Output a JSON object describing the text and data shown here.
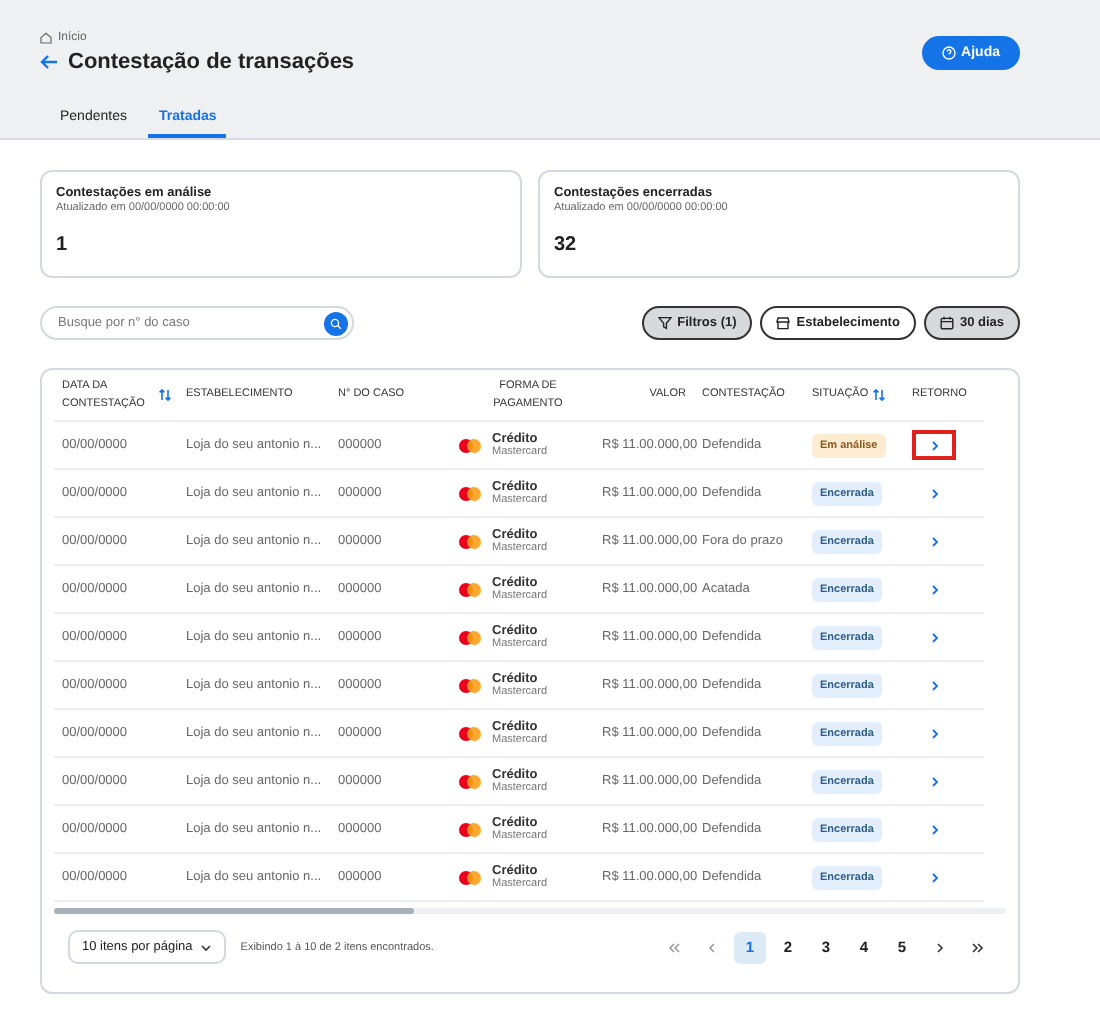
{
  "breadcrumb": "Início",
  "title": "Contestação de transações",
  "help_button": "Ajuda",
  "tabs": [
    {
      "label": "Pendentes",
      "selected": false
    },
    {
      "label": "Tratadas",
      "selected": true
    }
  ],
  "cards": [
    {
      "title": "Contestações em análise",
      "updated": "Atualizado em 00/00/0000 00:00:00",
      "value": "1"
    },
    {
      "title": "Contestações encerradas",
      "updated": "Atualizado em 00/00/0000 00:00:00",
      "value": "32"
    }
  ],
  "search": {
    "placeholder": "Busque por n° do caso"
  },
  "filters": [
    {
      "label": "Filtros (1)",
      "kind": "filter",
      "active": true
    },
    {
      "label": "Estabelecimento",
      "kind": "store",
      "active": false
    },
    {
      "label": "30 dias",
      "kind": "calendar",
      "active": true
    }
  ],
  "table": {
    "columns": [
      {
        "label": "DATA DA CONTESTAÇÃO",
        "sortable": true
      },
      {
        "label": "ESTABELECIMENTO",
        "sortable": false
      },
      {
        "label": "N° DO CASO",
        "sortable": false
      },
      {
        "label": "FORMA DE PAGAMENTO",
        "sortable": false
      },
      {
        "label": "VALOR",
        "sortable": false
      },
      {
        "label": "CONTESTAÇÃO",
        "sortable": false
      },
      {
        "label": "SITUAÇÃO",
        "sortable": true
      },
      {
        "label": "RETORNO",
        "sortable": false
      }
    ],
    "rows": [
      {
        "date": "00/00/0000",
        "store": "Loja do seu antonio n...",
        "case": "000000",
        "payment": "Crédito",
        "brand": "Mastercard",
        "value": "R$ 11.00.000,00",
        "dispute": "Defendida",
        "status": "Em análise",
        "kind": "analysis",
        "highlighted": true
      },
      {
        "date": "00/00/0000",
        "store": "Loja do seu antonio n...",
        "case": "000000",
        "payment": "Crédito",
        "brand": "Mastercard",
        "value": "R$ 11.00.000,00",
        "dispute": "Defendida",
        "status": "Encerrada",
        "kind": "closed",
        "highlighted": false
      },
      {
        "date": "00/00/0000",
        "store": "Loja do seu antonio n...",
        "case": "000000",
        "payment": "Crédito",
        "brand": "Mastercard",
        "value": "R$ 11.00.000,00",
        "dispute": "Fora do prazo",
        "status": "Encerrada",
        "kind": "closed",
        "highlighted": false
      },
      {
        "date": "00/00/0000",
        "store": "Loja do seu antonio n...",
        "case": "000000",
        "payment": "Crédito",
        "brand": "Mastercard",
        "value": "R$ 11.00.000,00",
        "dispute": "Acatada",
        "status": "Encerrada",
        "kind": "closed",
        "highlighted": false
      },
      {
        "date": "00/00/0000",
        "store": "Loja do seu antonio n...",
        "case": "000000",
        "payment": "Crédito",
        "brand": "Mastercard",
        "value": "R$ 11.00.000,00",
        "dispute": "Defendida",
        "status": "Encerrada",
        "kind": "closed",
        "highlighted": false
      },
      {
        "date": "00/00/0000",
        "store": "Loja do seu antonio n...",
        "case": "000000",
        "payment": "Crédito",
        "brand": "Mastercard",
        "value": "R$ 11.00.000,00",
        "dispute": "Defendida",
        "status": "Encerrada",
        "kind": "closed",
        "highlighted": false
      },
      {
        "date": "00/00/0000",
        "store": "Loja do seu antonio n...",
        "case": "000000",
        "payment": "Crédito",
        "brand": "Mastercard",
        "value": "R$ 11.00.000,00",
        "dispute": "Defendida",
        "status": "Encerrada",
        "kind": "closed",
        "highlighted": false
      },
      {
        "date": "00/00/0000",
        "store": "Loja do seu antonio n...",
        "case": "000000",
        "payment": "Crédito",
        "brand": "Mastercard",
        "value": "R$ 11.00.000,00",
        "dispute": "Defendida",
        "status": "Encerrada",
        "kind": "closed",
        "highlighted": false
      },
      {
        "date": "00/00/0000",
        "store": "Loja do seu antonio n...",
        "case": "000000",
        "payment": "Crédito",
        "brand": "Mastercard",
        "value": "R$ 11.00.000,00",
        "dispute": "Defendida",
        "status": "Encerrada",
        "kind": "closed",
        "highlighted": false
      },
      {
        "date": "00/00/0000",
        "store": "Loja do seu antonio n...",
        "case": "000000",
        "payment": "Crédito",
        "brand": "Mastercard",
        "value": "R$ 11.00.000,00",
        "dispute": "Defendida",
        "status": "Encerrada",
        "kind": "closed",
        "highlighted": false
      }
    ]
  },
  "pagination": {
    "page_size": "10 itens por página",
    "summary": "Exibindo 1 à 10 de 2 itens encontrados.",
    "pages": [
      {
        "label": "1",
        "selected": true
      },
      {
        "label": "2",
        "selected": false
      },
      {
        "label": "3",
        "selected": false
      },
      {
        "label": "4",
        "selected": false
      },
      {
        "label": "5",
        "selected": false
      }
    ]
  }
}
